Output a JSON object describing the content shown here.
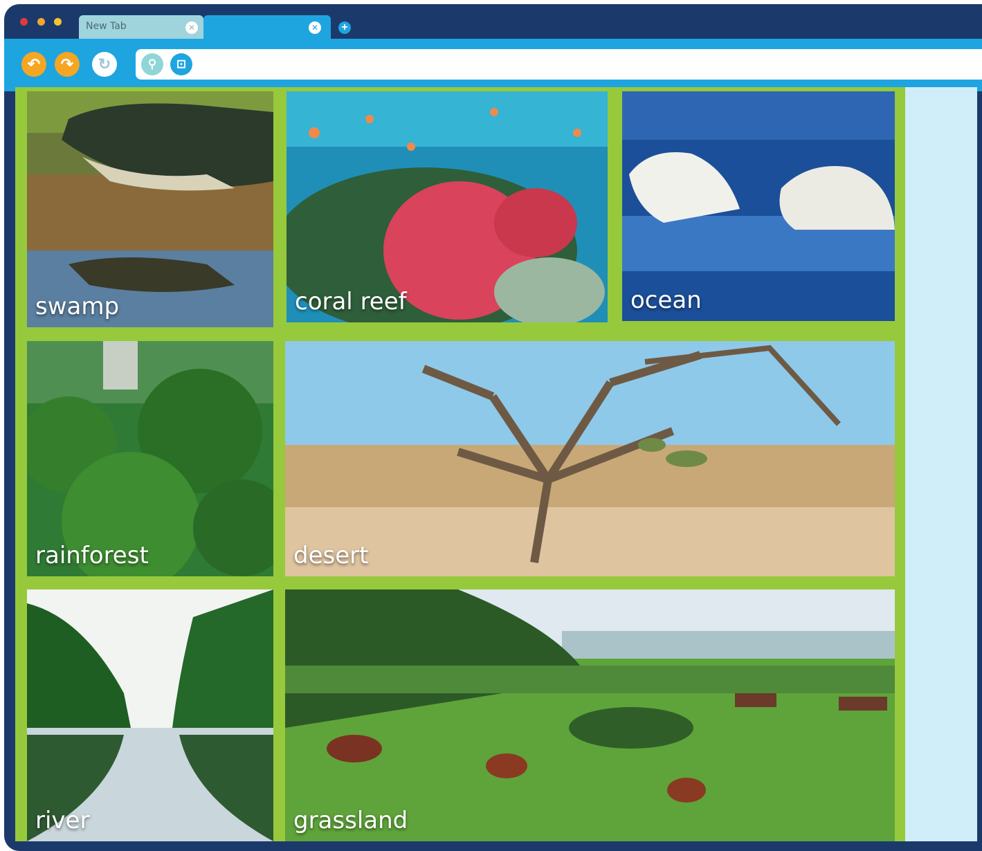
{
  "browser": {
    "tabs": [
      {
        "title": "New Tab"
      },
      {
        "title": ""
      }
    ],
    "url": ""
  },
  "tiles": {
    "swamp": {
      "label": "swamp"
    },
    "coral_reef": {
      "label": "coral reef"
    },
    "ocean": {
      "label": "ocean"
    },
    "rainforest": {
      "label": "rainforest"
    },
    "desert": {
      "label": "desert"
    },
    "river": {
      "label": "river"
    },
    "grassland": {
      "label": "grassland"
    }
  },
  "colors": {
    "frame": "#1b3a6b",
    "toolbar": "#1ea5e0",
    "grid_border": "#97c93c",
    "nav_button": "#f5a623",
    "page_background": "#cfeefa"
  },
  "icons": [
    "back-arrow-icon",
    "forward-arrow-icon",
    "reload-icon",
    "search-icon",
    "lock-icon",
    "close-icon",
    "plus-icon"
  ]
}
